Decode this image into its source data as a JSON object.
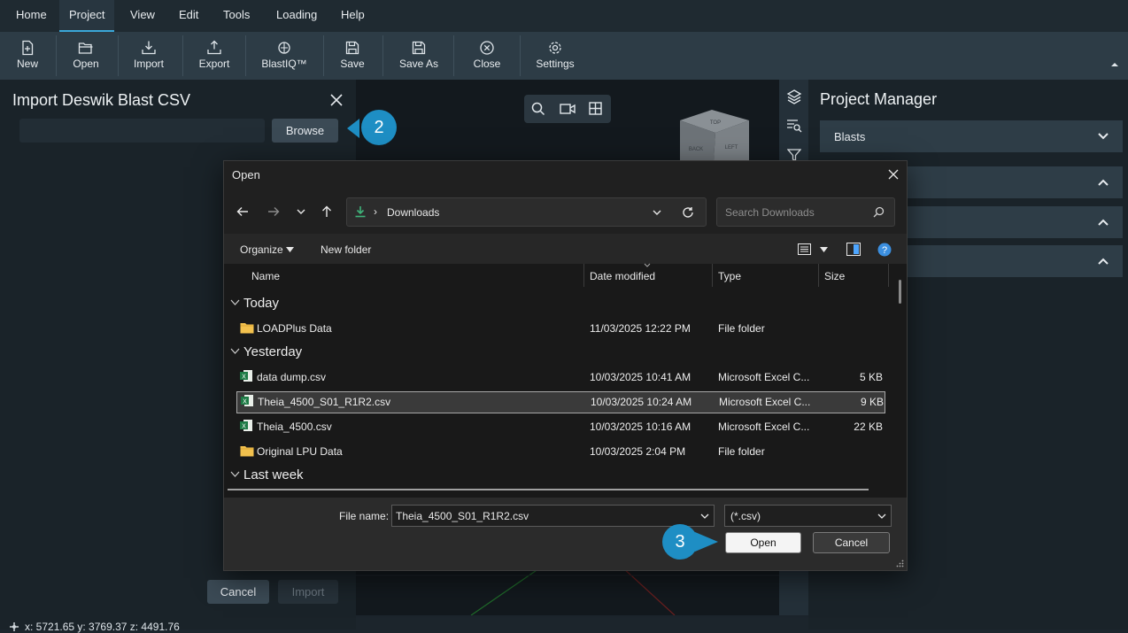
{
  "menu": {
    "items": [
      "Home",
      "Project",
      "View",
      "Edit",
      "Tools",
      "Loading",
      "Help"
    ],
    "active": "Project"
  },
  "toolbar": {
    "new_label": "New",
    "open_label": "Open",
    "import_label": "Import",
    "export_label": "Export",
    "blastiq_label": "BlastIQ™",
    "save_label": "Save",
    "save_as_label": "Save As",
    "close_label": "Close",
    "settings_label": "Settings"
  },
  "import_panel": {
    "title": "Import Deswik Blast CSV",
    "path_value": "",
    "browse_label": "Browse",
    "cancel_label": "Cancel",
    "import_label": "Import"
  },
  "callouts": {
    "step2": "2",
    "step3": "3"
  },
  "status_bar": {
    "coords": "x: 5721.65 y: 3769.37 z: 4491.76"
  },
  "project_manager": {
    "title": "Project Manager",
    "sections": [
      "Blasts",
      "",
      "",
      ""
    ]
  },
  "viewcube": {
    "top": "TOP",
    "back": "BACK",
    "left": "LEFT"
  },
  "dialog": {
    "title": "Open",
    "breadcrumb": "Downloads",
    "search_placeholder": "Search Downloads",
    "organize_label": "Organize",
    "new_folder_label": "New folder",
    "columns": {
      "name": "Name",
      "date": "Date modified",
      "type": "Type",
      "size": "Size"
    },
    "groups": {
      "today": "Today",
      "yesterday": "Yesterday",
      "last_week": "Last week"
    },
    "rows": [
      {
        "name": "LOADPlus Data",
        "date": "11/03/2025 12:22 PM",
        "type": "File folder",
        "size": "",
        "kind": "folder"
      },
      {
        "name": "data dump.csv",
        "date": "10/03/2025 10:41 AM",
        "type": "Microsoft Excel C...",
        "size": "5 KB",
        "kind": "excel"
      },
      {
        "name": "Theia_4500_S01_R1R2.csv",
        "date": "10/03/2025 10:24 AM",
        "type": "Microsoft Excel C...",
        "size": "9 KB",
        "kind": "excel",
        "selected": true
      },
      {
        "name": "Theia_4500.csv",
        "date": "10/03/2025 10:16 AM",
        "type": "Microsoft Excel C...",
        "size": "22 KB",
        "kind": "excel"
      },
      {
        "name": "Original LPU Data",
        "date": "10/03/2025 2:04 PM",
        "type": "File folder",
        "size": "",
        "kind": "folder"
      }
    ],
    "file_name_label": "File name:",
    "file_name_value": "Theia_4500_S01_R1R2.csv",
    "filter_value": "(*.csv)",
    "open_label": "Open",
    "cancel_label": "Cancel"
  },
  "colors": {
    "accent": "#3aa7d8",
    "callout": "#1e8ec4",
    "folder": "#f2c14e",
    "excel": "#1d7a45"
  }
}
